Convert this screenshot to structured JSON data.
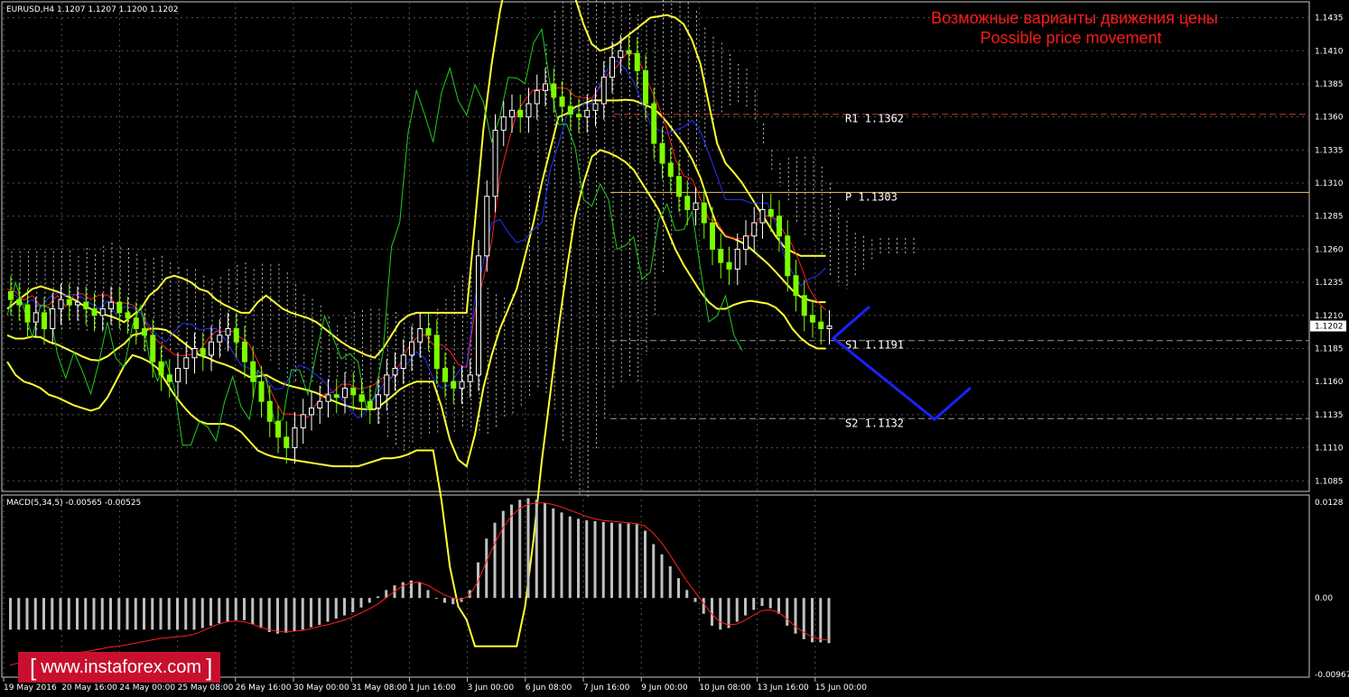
{
  "header": {
    "symbol_label": "EURUSD,H4  1.1207 1.1207 1.1200 1.1202",
    "macd_label": "MACD(5,34,5) -0.00565 -0.00525"
  },
  "annotation": {
    "line1": "Возможные варианты движения цены",
    "line2": "Possible price movement"
  },
  "logo": {
    "text": "www.instaforex.com"
  },
  "price_axis": {
    "ticks": [
      "1.1435",
      "1.1410",
      "1.1385",
      "1.1360",
      "1.1335",
      "1.1310",
      "1.1285",
      "1.1260",
      "1.1235",
      "1.1210",
      "1.1185",
      "1.1160",
      "1.1135",
      "1.1110",
      "1.1085"
    ],
    "current_price": "1.1202"
  },
  "macd_axis": {
    "ticks": [
      "0.0128",
      "0.00",
      "-0.00967"
    ]
  },
  "time_axis": {
    "labels": [
      "19 May 2016",
      "20 May 16:00",
      "24 May 00:00",
      "25 May 08:00",
      "26 May 16:00",
      "30 May 00:00",
      "31 May 08:00",
      "1 Jun 16:00",
      "3 Jun 00:00",
      "6 Jun 08:00",
      "7 Jun 16:00",
      "9 Jun 00:00",
      "10 Jun 08:00",
      "13 Jun 16:00",
      "15 Jun 00:00"
    ]
  },
  "levels": [
    {
      "name": "R1",
      "label": "R1 1.1362",
      "value": 1.1362,
      "style": "dashed",
      "color": "#c0392b"
    },
    {
      "name": "P",
      "label": "P  1.1303",
      "value": 1.1303,
      "style": "solid",
      "color": "#e6c35c"
    },
    {
      "name": "S1",
      "label": "S1 1.1191",
      "value": 1.1191,
      "style": "dashed",
      "color": "#9a9a9a"
    },
    {
      "name": "S2",
      "label": "S2 1.1132",
      "value": 1.1132,
      "style": "dashed",
      "color": "#9a9a9a"
    }
  ],
  "colors": {
    "background": "#000000",
    "bull_candle": "#ffffff",
    "bear_candle": "#7CFC00",
    "bollinger": "#ffff33",
    "tenkan": "#ff2020",
    "kijun": "#2233ff",
    "chikou": "#22cc22",
    "macd_hist": "#c0c0c0",
    "macd_signal": "#ff2020",
    "forecast": "#1a22ff"
  },
  "chart_data": {
    "type": "line",
    "title": "EURUSD,H4",
    "ylim": [
      1.1077,
      1.1447
    ],
    "macd_ylim": [
      -0.01,
      0.013
    ],
    "close": [
      1.1222,
      1.1218,
      1.1205,
      1.1212,
      1.12,
      1.1215,
      1.1222,
      1.1218,
      1.122,
      1.1215,
      1.121,
      1.1215,
      1.122,
      1.1212,
      1.1208,
      1.12,
      1.1195,
      1.1175,
      1.1165,
      1.116,
      1.117,
      1.1178,
      1.1185,
      1.118,
      1.119,
      1.1195,
      1.12,
      1.119,
      1.1175,
      1.116,
      1.1145,
      1.113,
      1.1118,
      1.111,
      1.1125,
      1.1135,
      1.114,
      1.1145,
      1.115,
      1.1148,
      1.1155,
      1.115,
      1.1145,
      1.114,
      1.115,
      1.1165,
      1.117,
      1.118,
      1.119,
      1.12,
      1.1195,
      1.117,
      1.116,
      1.1155,
      1.116,
      1.1165,
      1.1255,
      1.13,
      1.135,
      1.136,
      1.1365,
      1.136,
      1.137,
      1.138,
      1.1385,
      1.1375,
      1.1368,
      1.1362,
      1.136,
      1.1365,
      1.137,
      1.139,
      1.1405,
      1.141,
      1.1408,
      1.1395,
      1.137,
      1.134,
      1.1325,
      1.1315,
      1.13,
      1.129,
      1.1295,
      1.128,
      1.126,
      1.125,
      1.1245,
      1.126,
      1.127,
      1.128,
      1.129,
      1.1285,
      1.127,
      1.124,
      1.1225,
      1.121,
      1.1205,
      1.12,
      1.1202
    ],
    "bb_upper": [
      1.1215,
      1.122,
      1.1225,
      1.123,
      1.1232,
      1.123,
      1.1228,
      1.1225,
      1.1222,
      1.1218,
      1.1215,
      1.1212,
      1.121,
      1.1208,
      1.1205,
      1.121,
      1.1215,
      1.1225,
      1.123,
      1.1238,
      1.124,
      1.1238,
      1.1235,
      1.123,
      1.1228,
      1.1222,
      1.1218,
      1.1215,
      1.1212,
      1.1212,
      1.122,
      1.1225,
      1.122,
      1.1215,
      1.1212,
      1.121,
      1.1208,
      1.1205,
      1.12,
      1.1195,
      1.119,
      1.1186,
      1.1183,
      1.118,
      1.1178,
      1.1185,
      1.1195,
      1.1205,
      1.121,
      1.1212,
      1.1212,
      1.1212,
      1.1212,
      1.1212,
      1.1212,
      1.1212,
      1.128,
      1.135,
      1.14,
      1.144,
      1.147,
      1.15,
      1.152,
      1.152,
      1.152,
      1.152,
      1.152,
      1.148,
      1.145,
      1.143,
      1.1415,
      1.141,
      1.1412,
      1.1415,
      1.142,
      1.1425,
      1.143,
      1.1435,
      1.1436,
      1.1437,
      1.1435,
      1.143,
      1.1418,
      1.14,
      1.137,
      1.134,
      1.1325,
      1.1318,
      1.131,
      1.13,
      1.129,
      1.128,
      1.127,
      1.1262,
      1.1258,
      1.1255,
      1.1255,
      1.1255,
      1.1255
    ],
    "bb_lower": [
      1.1175,
      1.1165,
      1.116,
      1.1158,
      1.1155,
      1.115,
      1.1148,
      1.1145,
      1.1142,
      1.114,
      1.1138,
      1.114,
      1.1148,
      1.116,
      1.1172,
      1.118,
      1.1178,
      1.1175,
      1.117,
      1.116,
      1.115,
      1.1142,
      1.1135,
      1.113,
      1.1128,
      1.1128,
      1.1128,
      1.1126,
      1.1122,
      1.1115,
      1.1108,
      1.1105,
      1.1103,
      1.1102,
      1.1101,
      1.11,
      1.1099,
      1.1098,
      1.1097,
      1.1096,
      1.1096,
      1.1096,
      1.1096,
      1.1098,
      1.11,
      1.1102,
      1.1102,
      1.1103,
      1.1105,
      1.1108,
      1.1108,
      1.1108,
      1.107,
      1.102,
      1.099,
      1.098,
      1.096,
      1.096,
      1.096,
      1.096,
      1.096,
      1.096,
      1.099,
      1.104,
      1.11,
      1.115,
      1.12,
      1.1245,
      1.1285,
      1.131,
      1.133,
      1.1335,
      1.1333,
      1.133,
      1.1326,
      1.132,
      1.131,
      1.13,
      1.129,
      1.1275,
      1.126,
      1.1248,
      1.1238,
      1.1228,
      1.122,
      1.1215,
      1.1215,
      1.1218,
      1.122,
      1.1221,
      1.122,
      1.1219,
      1.1216,
      1.121,
      1.12,
      1.1193,
      1.1188,
      1.1185,
      1.1185
    ],
    "macd": [
      -0.004,
      -0.004,
      -0.004,
      -0.004,
      -0.004,
      -0.004,
      -0.004,
      -0.004,
      -0.004,
      -0.004,
      -0.004,
      -0.004,
      -0.004,
      -0.004,
      -0.004,
      -0.004,
      -0.004,
      -0.004,
      -0.004,
      -0.004,
      -0.004,
      -0.004,
      -0.004,
      -0.0038,
      -0.0035,
      -0.0032,
      -0.003,
      -0.0028,
      -0.0028,
      -0.0033,
      -0.0038,
      -0.0043,
      -0.0045,
      -0.0044,
      -0.0042,
      -0.004,
      -0.0037,
      -0.0034,
      -0.003,
      -0.0026,
      -0.0022,
      -0.0018,
      -0.0012,
      -0.0006,
      0.0002,
      0.001,
      0.0016,
      0.002,
      0.0022,
      0.002,
      0.001,
      0.0,
      -0.0006,
      -0.0008,
      -0.0005,
      0.001,
      0.0045,
      0.0075,
      0.0095,
      0.011,
      0.0118,
      0.0124,
      0.0126,
      0.0124,
      0.012,
      0.0113,
      0.0108,
      0.0103,
      0.01,
      0.0098,
      0.0097,
      0.0096,
      0.0095,
      0.0094,
      0.0094,
      0.0093,
      0.0085,
      0.0068,
      0.0055,
      0.004,
      0.0025,
      0.001,
      -0.0005,
      -0.002,
      -0.0035,
      -0.004,
      -0.0038,
      -0.003,
      -0.0022,
      -0.0015,
      -0.001,
      -0.0013,
      -0.002,
      -0.0035,
      -0.0045,
      -0.0052,
      -0.0056,
      -0.0056,
      -0.0057
    ],
    "macd_signal": [
      -0.0085,
      -0.0082,
      -0.008,
      -0.0077,
      -0.0075,
      -0.0073,
      -0.0072,
      -0.007,
      -0.0069,
      -0.0068,
      -0.0066,
      -0.0064,
      -0.0062,
      -0.0061,
      -0.0059,
      -0.0057,
      -0.0055,
      -0.0053,
      -0.0051,
      -0.005,
      -0.0049,
      -0.0048,
      -0.0046,
      -0.0042,
      -0.0037,
      -0.0033,
      -0.003,
      -0.0029,
      -0.003,
      -0.0033,
      -0.0037,
      -0.004,
      -0.0042,
      -0.0043,
      -0.0042,
      -0.0041,
      -0.0039,
      -0.0036,
      -0.0034,
      -0.0031,
      -0.0028,
      -0.0024,
      -0.0019,
      -0.0014,
      -0.0008,
      0.0,
      0.0008,
      0.0015,
      0.0019,
      0.002,
      0.0016,
      0.001,
      0.0004,
      0.0,
      -0.0002,
      0.0003,
      0.002,
      0.0045,
      0.0068,
      0.0088,
      0.0103,
      0.0113,
      0.0118,
      0.012,
      0.012,
      0.0118,
      0.0115,
      0.0111,
      0.0107,
      0.0103,
      0.01,
      0.0098,
      0.0097,
      0.0096,
      0.0095,
      0.0094,
      0.0091,
      0.0082,
      0.007,
      0.0055,
      0.0038,
      0.0022,
      0.0008,
      -0.0006,
      -0.002,
      -0.003,
      -0.0034,
      -0.0033,
      -0.0028,
      -0.0022,
      -0.0016,
      -0.0015,
      -0.0018,
      -0.0026,
      -0.0036,
      -0.0043,
      -0.0049,
      -0.0052,
      -0.0053
    ]
  }
}
